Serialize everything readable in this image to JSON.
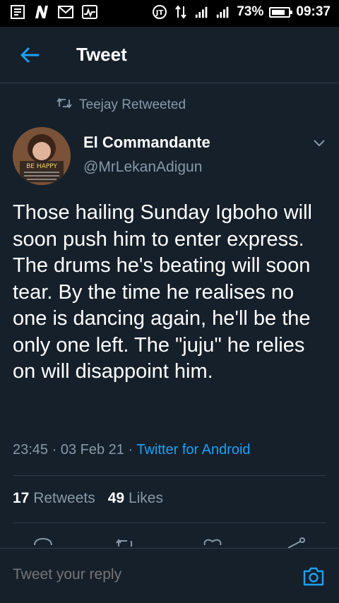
{
  "status_bar": {
    "battery_percent": "73%",
    "time": "09:37",
    "icons": [
      "notes-icon",
      "n-app-icon",
      "mail-icon",
      "activity-icon",
      "headset-icon",
      "data-arrows-icon",
      "signal-icon",
      "signal-icon"
    ]
  },
  "header": {
    "title": "Tweet",
    "back_icon": "arrow-left-icon"
  },
  "retweet": {
    "text": "Teejay Retweeted"
  },
  "author": {
    "name": "El Commandante",
    "handle": "@MrLekanAdigun",
    "avatar_caption": "BE HAPPY"
  },
  "tweet": {
    "text": "Those hailing Sunday Igboho will soon push him to enter express. The drums he's beating will soon tear. By the time he realises no one is dancing again, he'll be the only one left. The \"juju\" he relies on will disappoint him.",
    "time": "23:45",
    "date": "03 Feb 21",
    "source": "Twitter for Android"
  },
  "stats": {
    "retweets_count": "17",
    "retweets_label": "Retweets",
    "likes_count": "49",
    "likes_label": "Likes"
  },
  "reply": {
    "placeholder": "Tweet your reply"
  },
  "colors": {
    "background": "#15202b",
    "accent": "#1da1f2",
    "muted": "#8899a6"
  }
}
